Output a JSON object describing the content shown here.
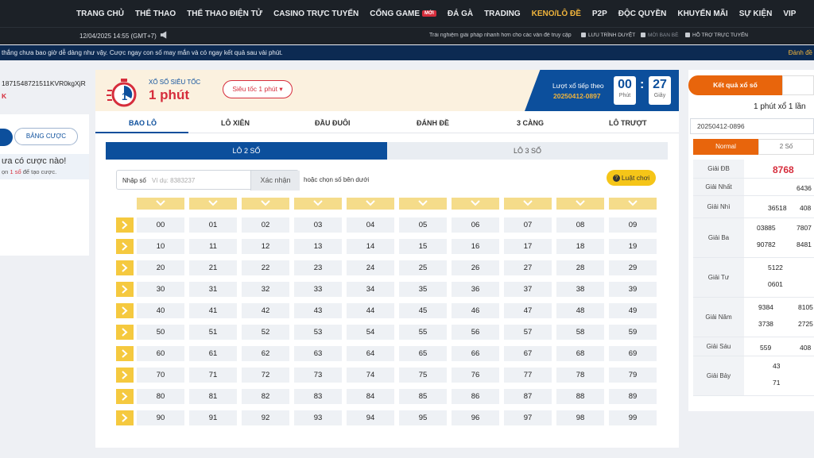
{
  "nav": {
    "items": [
      "TRANG CHỦ",
      "THỂ THAO",
      "THỂ THAO ĐIỆN TỬ",
      "CASINO TRỰC TUYẾN",
      "CỔNG GAME",
      "ĐÁ GÀ",
      "TRADING",
      "KENO/LÔ ĐỀ",
      "P2P",
      "ĐỘC QUYỀN",
      "KHUYẾN MÃI",
      "SỰ KIỆN",
      "VIP"
    ],
    "new_badge": "MỚI",
    "active": "KENO/LÔ ĐỀ"
  },
  "subbar": {
    "datetime": "12/04/2025 14:55 (GMT+7)",
    "promo": "Trải nghiệm giải pháp nhanh hơn cho các vấn đề truy cập",
    "links": [
      "LƯU TRÌNH DUYỆT",
      "MỜI BẠN BÈ",
      "HỖ TRỢ TRỰC TUYẾN"
    ]
  },
  "marquee": {
    "text": "thắng chưa bao giờ dễ dàng như vậy. Cược ngay con số may mắn và có ngay kết quả sau vài phút.",
    "right": "Đánh đề"
  },
  "left": {
    "user_id": "1871548721511KVR0kgXjR",
    "k": "K",
    "bet_tab": "BẢNG CƯỢC",
    "empty_title": "ưa có cược nào!",
    "empty_sub_a": "ọn",
    "empty_sub_b": "1 số",
    "empty_sub_c": "để tạo cược."
  },
  "header": {
    "logo_small": "XỔ SỐ SIÊU TỐC",
    "logo_big": "1 phút",
    "speed": "Siêu tốc 1 phút",
    "next_label": "Lượt xổ tiếp theo",
    "next_id": "20250412-0897",
    "minutes": "00",
    "minutes_unit": "Phút",
    "seconds": "27",
    "seconds_unit": "Giây"
  },
  "tabs": [
    "BAO LÔ",
    "LÔ XIÊN",
    "ĐẦU ĐUÔI",
    "ĐÁNH ĐỀ",
    "3 CÀNG",
    "LÔ TRƯỢT"
  ],
  "subtabs": [
    "LÔ 2 SỐ",
    "LÔ 3 SỐ"
  ],
  "input": {
    "label": "Nhập số",
    "placeholder": "Ví dụ: 8383237",
    "confirm": "Xác nhận",
    "hint": "hoặc chọn số bên dưới",
    "rules": "Luật chơi"
  },
  "numbers": [
    [
      "00",
      "01",
      "02",
      "03",
      "04",
      "05",
      "06",
      "07",
      "08",
      "09"
    ],
    [
      "10",
      "11",
      "12",
      "13",
      "14",
      "15",
      "16",
      "17",
      "18",
      "19"
    ],
    [
      "20",
      "21",
      "22",
      "23",
      "24",
      "25",
      "26",
      "27",
      "28",
      "29"
    ],
    [
      "30",
      "31",
      "32",
      "33",
      "34",
      "35",
      "36",
      "37",
      "38",
      "39"
    ],
    [
      "40",
      "41",
      "42",
      "43",
      "44",
      "45",
      "46",
      "47",
      "48",
      "49"
    ],
    [
      "50",
      "51",
      "52",
      "53",
      "54",
      "55",
      "56",
      "57",
      "58",
      "59"
    ],
    [
      "60",
      "61",
      "62",
      "63",
      "64",
      "65",
      "66",
      "67",
      "68",
      "69"
    ],
    [
      "70",
      "71",
      "72",
      "73",
      "74",
      "75",
      "76",
      "77",
      "78",
      "79"
    ],
    [
      "80",
      "81",
      "82",
      "83",
      "84",
      "85",
      "86",
      "87",
      "88",
      "89"
    ],
    [
      "90",
      "91",
      "92",
      "93",
      "94",
      "95",
      "96",
      "97",
      "98",
      "99"
    ]
  ],
  "results": {
    "tab": "Kết quả xổ số",
    "title": "1 phút xổ 1 lần",
    "draw_id": "20250412-0896",
    "mode_active": "Normal",
    "mode_other": "2 Số",
    "prizes": [
      {
        "label": "Giải ĐB",
        "values": [
          "8768"
        ]
      },
      {
        "label": "Giải Nhất",
        "values": [
          "6436"
        ]
      },
      {
        "label": "Giải Nhì",
        "values": [
          "36518",
          "408"
        ]
      },
      {
        "label": "Giải Ba",
        "values": [
          "03885",
          "7807",
          "90782",
          "8481"
        ]
      },
      {
        "label": "Giải Tư",
        "values": [
          "5122",
          "0601"
        ]
      },
      {
        "label": "Giải Năm",
        "values": [
          "9384",
          "8105",
          "3738",
          "2725"
        ]
      },
      {
        "label": "Giải Sáu",
        "values": [
          "559",
          "408"
        ]
      },
      {
        "label": "Giải Bảy",
        "values": [
          "43",
          "71"
        ]
      }
    ]
  },
  "colors": {
    "nav_bg": "#1c2127",
    "accent_blue": "#0c4f9c",
    "accent_red": "#d62d3c",
    "accent_orange": "#e8650c",
    "gold": "#f5c93f"
  }
}
